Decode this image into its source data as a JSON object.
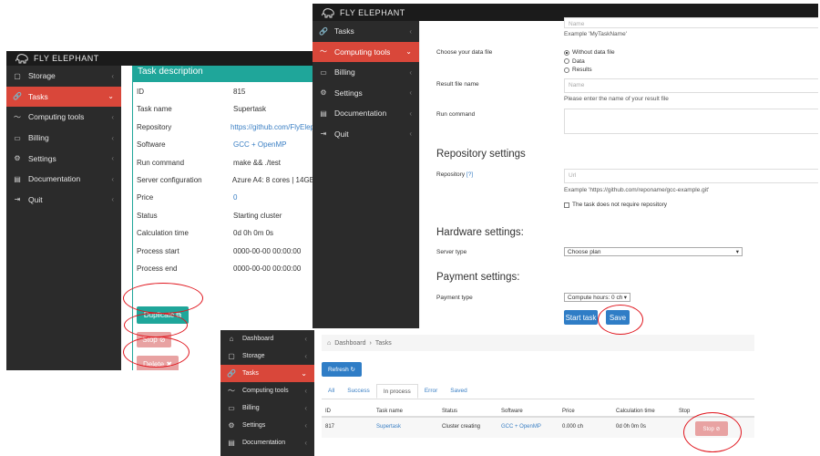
{
  "app": {
    "brand": "FLY ELEPHANT"
  },
  "panel1": {
    "sidebar": [
      {
        "label": "Storage",
        "icon": "folder-icon",
        "active": false,
        "glyph": "▢"
      },
      {
        "label": "Tasks",
        "icon": "paperclip-icon",
        "active": true,
        "glyph": "🔗"
      },
      {
        "label": "Computing tools",
        "icon": "chart-line-icon",
        "active": false,
        "glyph": "〜"
      },
      {
        "label": "Billing",
        "icon": "wallet-icon",
        "active": false,
        "glyph": "▭"
      },
      {
        "label": "Settings",
        "icon": "gear-icon",
        "active": false,
        "glyph": "⚙"
      },
      {
        "label": "Documentation",
        "icon": "comment-icon",
        "active": false,
        "glyph": "▤"
      },
      {
        "label": "Quit",
        "icon": "sign-out-icon",
        "active": false,
        "glyph": "⇥"
      }
    ],
    "title": "Task description",
    "rows": [
      {
        "label": "ID",
        "value": "815",
        "link": false
      },
      {
        "label": "Task name",
        "value": "Supertask",
        "link": false
      },
      {
        "label": "Repository",
        "value": "https://github.com/FlyElep",
        "link": true
      },
      {
        "label": "Software",
        "value": "GCC + OpenMP",
        "link": true
      },
      {
        "label": "Run command",
        "value": "make && ./test",
        "link": false
      },
      {
        "label": "Server configuration",
        "value": "Azure A4: 8 cores | 14GB",
        "link": false
      },
      {
        "label": "Price",
        "value": "0",
        "link": true
      },
      {
        "label": "Status",
        "value": "Starting cluster",
        "link": false
      },
      {
        "label": "Calculation time",
        "value": "0d 0h 0m 0s",
        "link": false
      },
      {
        "label": "Process start",
        "value": "0000-00-00 00:00:00",
        "link": false
      },
      {
        "label": "Process end",
        "value": "0000-00-00 00:00:00",
        "link": false
      }
    ],
    "buttons": {
      "duplicate": "Duplicate ⧉",
      "stop": "Stop ⊘",
      "delete": "Delete ✖"
    }
  },
  "panel2": {
    "sidebar": [
      {
        "label": "Tasks",
        "icon": "paperclip-icon",
        "active": false,
        "glyph": "🔗"
      },
      {
        "label": "Computing tools",
        "icon": "chart-line-icon",
        "active": true,
        "glyph": "〜"
      },
      {
        "label": "Billing",
        "icon": "wallet-icon",
        "active": false,
        "glyph": "▭"
      },
      {
        "label": "Settings",
        "icon": "gear-icon",
        "active": false,
        "glyph": "⚙"
      },
      {
        "label": "Documentation",
        "icon": "comment-icon",
        "active": false,
        "glyph": "▤"
      },
      {
        "label": "Quit",
        "icon": "sign-out-icon",
        "active": false,
        "glyph": "⇥"
      }
    ],
    "name_placeholder": "Name",
    "name_hint": "Example 'MyTaskName'",
    "data_file_label": "Choose your data file",
    "data_file_options": [
      {
        "label": "Without data file",
        "checked": true
      },
      {
        "label": "Data",
        "checked": false
      },
      {
        "label": "Results",
        "checked": false
      }
    ],
    "result_file_label": "Result file name",
    "result_file_placeholder": "Name",
    "result_file_hint": "Please enter the name of your result file",
    "run_command_label": "Run command",
    "repo_heading": "Repository settings",
    "repo_label": "Repository",
    "repo_help": "[?]",
    "repo_placeholder": "Url",
    "repo_hint": "Example 'https://github.com/reponame/gcc-example.git'",
    "repo_checkbox": "The task does not require repository",
    "hardware_heading": "Hardware settings:",
    "server_type_label": "Server type",
    "server_type_value": "Choose plan",
    "payment_heading": "Payment settings:",
    "payment_type_label": "Payment type",
    "payment_type_value": "Compute hours: 0 ch",
    "start_button": "Start task",
    "save_button": "Save"
  },
  "panel3": {
    "sidebar": [
      {
        "label": "Dashboard",
        "icon": "home-icon",
        "active": false,
        "glyph": "⌂"
      },
      {
        "label": "Storage",
        "icon": "folder-icon",
        "active": false,
        "glyph": "▢"
      },
      {
        "label": "Tasks",
        "icon": "paperclip-icon",
        "active": true,
        "glyph": "🔗"
      },
      {
        "label": "Computing tools",
        "icon": "chart-line-icon",
        "active": false,
        "glyph": "〜"
      },
      {
        "label": "Billing",
        "icon": "wallet-icon",
        "active": false,
        "glyph": "▭"
      },
      {
        "label": "Settings",
        "icon": "gear-icon",
        "active": false,
        "glyph": "⚙"
      },
      {
        "label": "Documentation",
        "icon": "comment-icon",
        "active": false,
        "glyph": "▤"
      }
    ],
    "breadcrumb": {
      "home": "Dashboard",
      "sep": "›",
      "current": "Tasks"
    },
    "refresh_button": "Refresh ↻",
    "tabs": [
      {
        "label": "All",
        "active": false
      },
      {
        "label": "Success",
        "active": false
      },
      {
        "label": "In process",
        "active": true
      },
      {
        "label": "Error",
        "active": false
      },
      {
        "label": "Saved",
        "active": false
      }
    ],
    "columns": [
      "ID",
      "Task name",
      "Status",
      "Software",
      "Price",
      "Calculation time",
      "Stop"
    ],
    "row": {
      "id": "817",
      "task_name": "Supertask",
      "status": "Cluster creating",
      "software": "GCC + OpenMP",
      "price": "0.000 ch",
      "calc_time": "0d 0h 0m 0s",
      "stop": "Stop ⊘"
    }
  },
  "colors": {
    "accent_red": "#d9473a",
    "teal": "#1fa69a",
    "blue": "#2f7dc6",
    "sidebar_bg": "#2b2b2b",
    "highlight_ellipse": "#e0161e"
  }
}
